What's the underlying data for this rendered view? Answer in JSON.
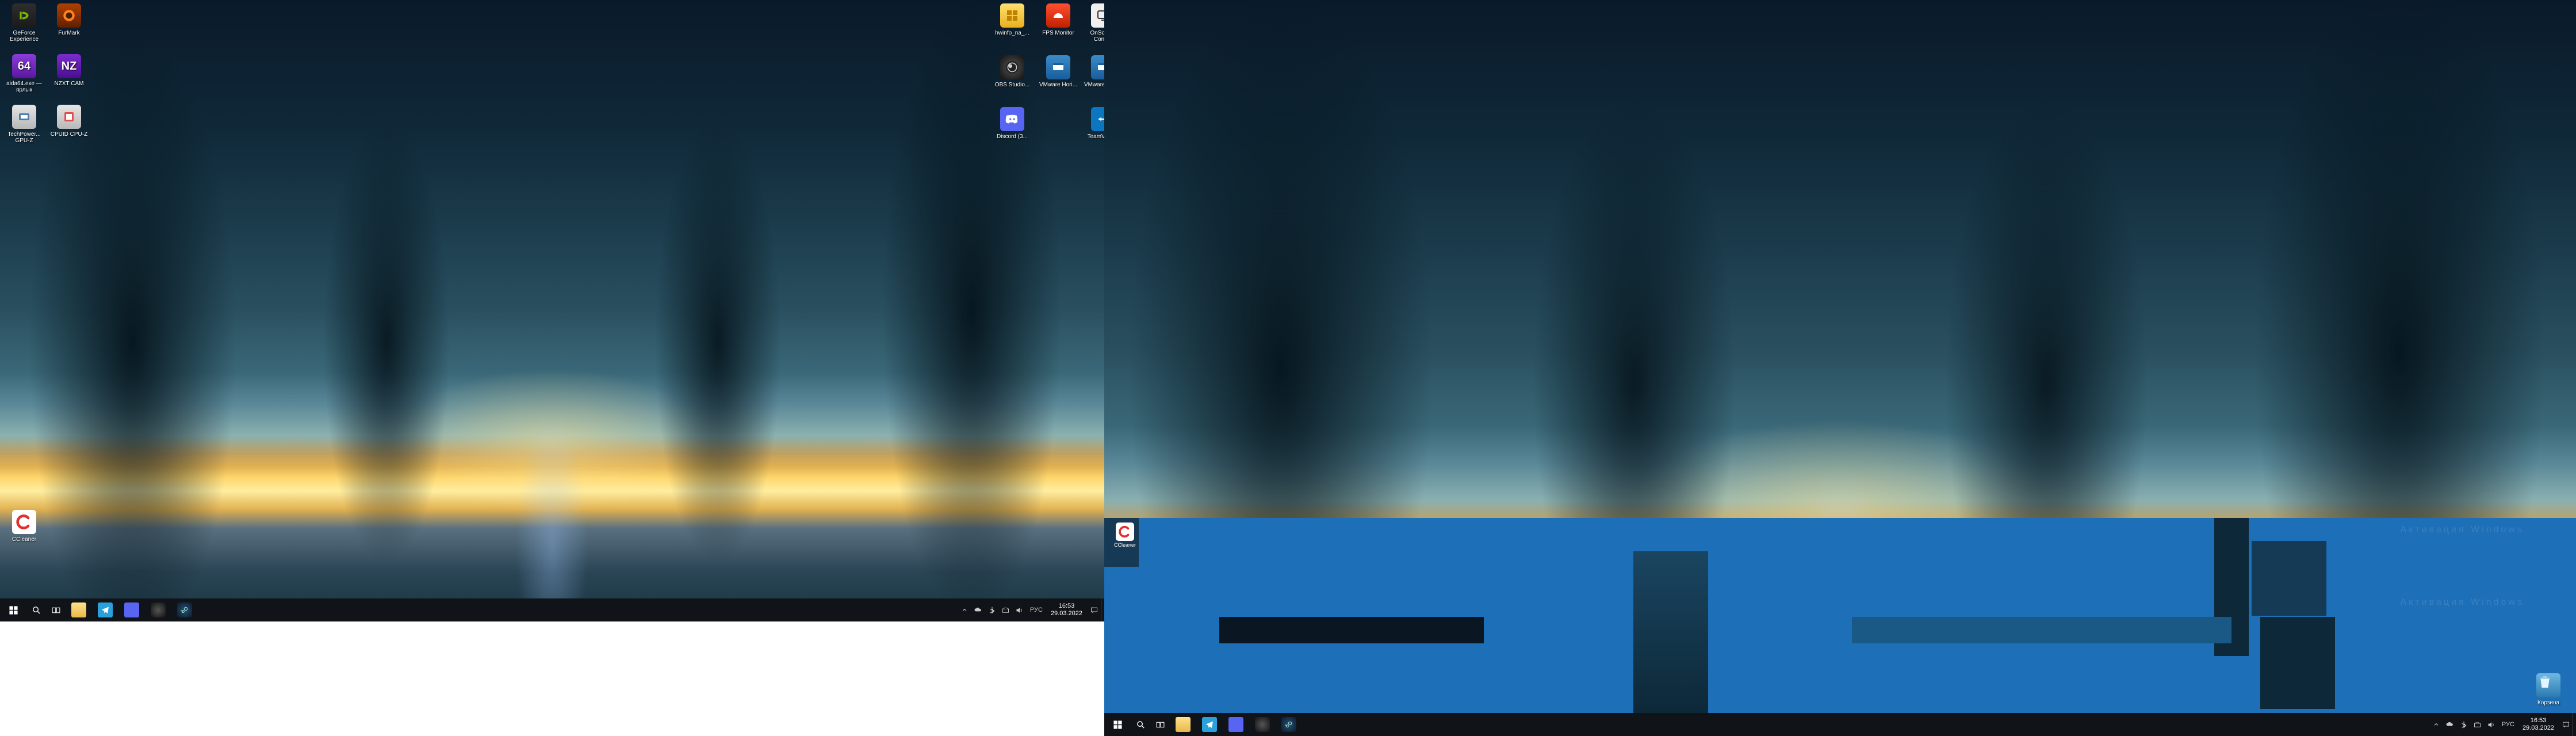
{
  "left": {
    "desktop": {
      "col1": [
        {
          "label": "GeForce Experience",
          "icon": "nvidia"
        },
        {
          "label": "aida64.exe — ярлык",
          "icon": "aida64",
          "badge": "64"
        },
        {
          "label": "TechPower... GPU-Z",
          "icon": "gpuz"
        }
      ],
      "col2": [
        {
          "label": "FurMark",
          "icon": "furmark"
        },
        {
          "label": "NZXT CAM",
          "icon": "nzxt",
          "badge": "NZ"
        },
        {
          "label": "CPUID CPU-Z",
          "icon": "cpuid"
        }
      ],
      "ccleaner": {
        "label": "CCleaner",
        "icon": "cc"
      },
      "grpA": [
        {
          "label": "hwinfo_na_...",
          "icon": "hwinfo"
        },
        {
          "label": "OBS Studio...",
          "icon": "obs"
        },
        {
          "label": "Discord (3...",
          "icon": "discord"
        }
      ],
      "grpB": [
        {
          "label": "FPS Monitor",
          "icon": "fps"
        },
        {
          "label": "VMware Hori...",
          "icon": "vmware"
        }
      ],
      "grpC": [
        {
          "label": "OnScreen Control",
          "icon": "osc"
        },
        {
          "label": "VMware Hori...",
          "icon": "vmware"
        },
        {
          "label": "TeamViewer",
          "icon": "tv"
        }
      ]
    },
    "taskbar": {
      "pinned": [
        "start",
        "search",
        "taskview",
        "explorer",
        "telegram",
        "discord",
        "obs",
        "steam"
      ],
      "tray": [
        "chevron",
        "onedrive",
        "bluetooth",
        "network",
        "volume",
        "lang"
      ],
      "lang": "РУС",
      "time": "16:53",
      "date": "29.03.2022"
    }
  },
  "right": {
    "ccghost": "CCleaner",
    "watermark": "Активация Windows",
    "recycle": "Корзина",
    "taskbar": {
      "pinned": [
        "start",
        "search",
        "taskview",
        "explorer",
        "telegram",
        "discord",
        "obs",
        "steam"
      ],
      "tray": [
        "chevron",
        "onedrive",
        "bluetooth",
        "network",
        "volume",
        "lang"
      ],
      "lang": "РУС",
      "time": "16:53",
      "date": "29.03.2022"
    }
  }
}
